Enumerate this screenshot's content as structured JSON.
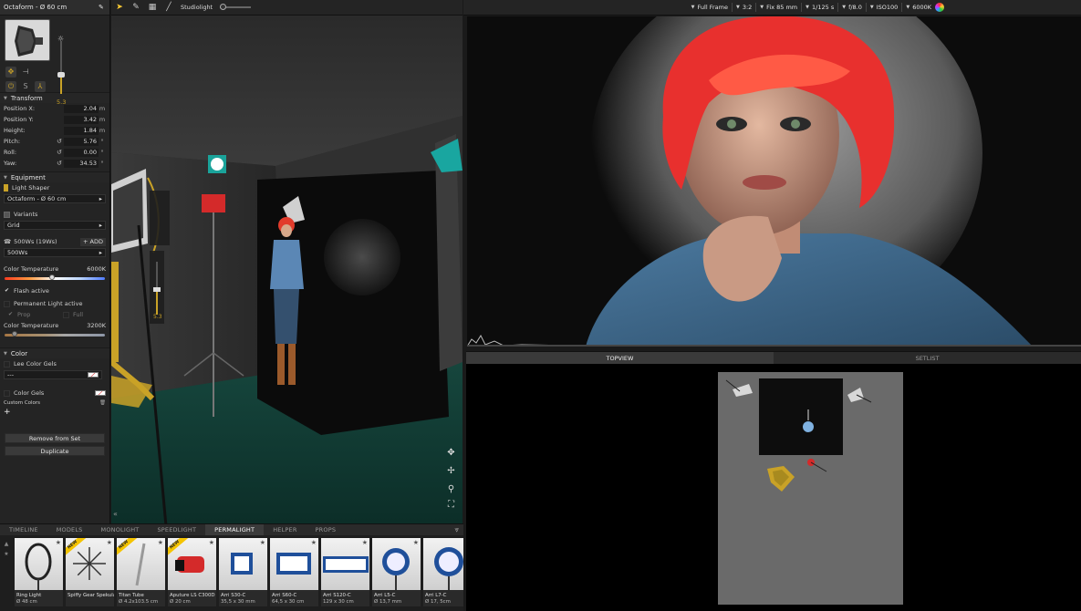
{
  "left_panel": {
    "title": "Octaform - Ø 60 cm",
    "intensity_value": "5.3",
    "transform": {
      "label": "Transform",
      "fields": [
        {
          "label": "Position X:",
          "value": "2.04",
          "unit": "m"
        },
        {
          "label": "Position Y:",
          "value": "3.42",
          "unit": "m"
        },
        {
          "label": "Height:",
          "value": "1.84",
          "unit": "m"
        },
        {
          "label": "Pitch:",
          "value": "5.76",
          "unit": "°"
        },
        {
          "label": "Roll:",
          "value": "0.00",
          "unit": "°"
        },
        {
          "label": "Yaw:",
          "value": "34.53",
          "unit": "°"
        }
      ]
    },
    "equipment": {
      "label": "Equipment",
      "light_shaper_label": "Light Shaper",
      "light_shaper_value": "Octaform - Ø 60 cm",
      "variants_label": "Variants",
      "variants_value": "Grid",
      "power_label": "500Ws (19Ws)",
      "add_label": "ADD",
      "power_value": "500Ws",
      "color_temp_label": "Color Temperature",
      "color_temp_value": "6000K",
      "color_temp_fraction": 0.47,
      "flash_active_label": "Flash active",
      "permanent_light_label": "Permanent Light active",
      "prop_label": "Prop",
      "full_label": "Full",
      "color_temp2_label": "Color Temperature",
      "color_temp2_value": "3200K",
      "color_temp2_fraction": 0.1
    },
    "color": {
      "label": "Color",
      "lee_label": "Lee Color Gels",
      "lee_value": "---",
      "gels_label": "Color Gels",
      "custom_label": "Custom Colors",
      "add_symbol": "+"
    },
    "remove_label": "Remove from Set",
    "duplicate_label": "Duplicate"
  },
  "viewport": {
    "studiolight_label": "Studiolight",
    "side_value": "5.3"
  },
  "library": {
    "tabs": [
      "TIMELINE",
      "MODELS",
      "MONOLIGHT",
      "SPEEDLIGHT",
      "PERMALIGHT",
      "HELPER",
      "PROPS"
    ],
    "active_tab": "PERMALIGHT",
    "items": [
      {
        "name": "Ring Light",
        "spec": "Ø 48 cm",
        "new": false
      },
      {
        "name": "Spiffy Gear Spekular",
        "spec": "",
        "new": true
      },
      {
        "name": "Titan Tube",
        "spec": "Ø 4.2x103.5 cm",
        "new": true
      },
      {
        "name": "Aputure LS C300D II",
        "spec": "Ø 20 cm",
        "new": true
      },
      {
        "name": "Arri S30-C",
        "spec": "35,5 x 30 mm",
        "new": false
      },
      {
        "name": "Arri S60-C",
        "spec": "64,5 x 30 cm",
        "new": false
      },
      {
        "name": "Arri S120-C",
        "spec": "129 x 30 cm",
        "new": false
      },
      {
        "name": "Arri L5-C",
        "spec": "Ø 13,7 mm",
        "new": false
      },
      {
        "name": "Arri L7-C",
        "spec": "Ø 17, 5cm",
        "new": false
      }
    ],
    "new_badge": "NEW"
  },
  "camera": {
    "frame": "Full Frame",
    "ratio": "3:2",
    "lens": "Fix 85 mm",
    "shutter": "1/125 s",
    "aperture": "f/8.0",
    "iso": "ISO100",
    "white_balance": "6000K"
  },
  "topview": {
    "tabs": [
      "TOPVIEW",
      "SETLIST"
    ],
    "active_tab": "TOPVIEW"
  },
  "colors": {
    "accent": "#c9a227",
    "hair": "#e8302e",
    "floor": "#0f3a32"
  }
}
